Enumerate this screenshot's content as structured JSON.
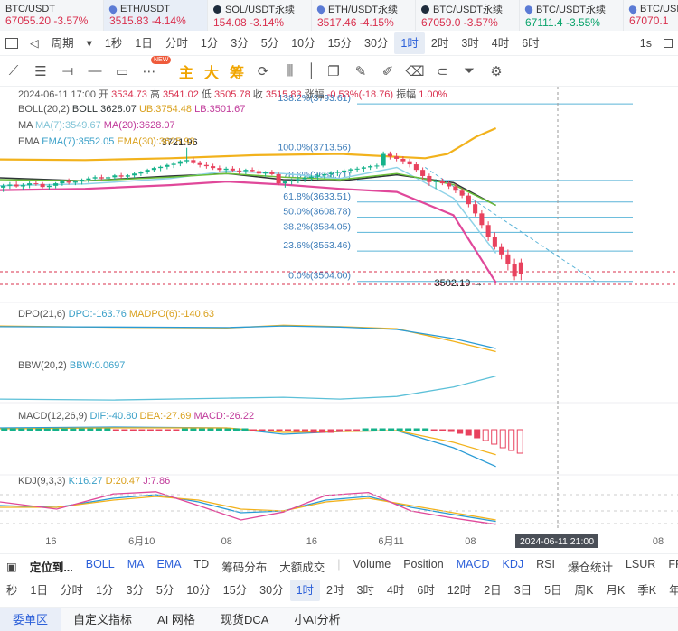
{
  "tickers": [
    {
      "symbol": "BTC/USDT",
      "price": "67055.20",
      "change": "-3.57%",
      "icon": "none",
      "up": false
    },
    {
      "symbol": "ETH/USDT",
      "price": "3515.83",
      "change": "-4.14%",
      "icon": "drop",
      "up": false,
      "active": true
    },
    {
      "symbol": "SOL/USDT永续",
      "price": "154.08",
      "change": "-3.14%",
      "icon": "dot",
      "up": false
    },
    {
      "symbol": "ETH/USDT永续",
      "price": "3517.46",
      "change": "-4.15%",
      "icon": "drop",
      "up": false
    },
    {
      "symbol": "BTC/USDT永续",
      "price": "67059.0",
      "change": "-3.57%",
      "icon": "dot",
      "up": false
    },
    {
      "symbol": "BTC/USDT永续",
      "price": "67111.4",
      "change": "-3.55%",
      "icon": "drop",
      "up": true
    },
    {
      "symbol": "BTC/USDT",
      "price": "67070.1",
      "change": "",
      "icon": "drop",
      "up": false
    }
  ],
  "timeframes": {
    "period_label": "周期",
    "items": [
      "1秒",
      "1日",
      "分时",
      "1分",
      "3分",
      "5分",
      "10分",
      "15分",
      "30分",
      "1时",
      "2时",
      "3时",
      "4时",
      "6时"
    ],
    "active": "1时",
    "right": "1s"
  },
  "toolbar": {
    "icons": [
      "line-tool-icon",
      "parallel-tool-icon",
      "hline-tool-icon",
      "rect-tool-icon",
      "more-tools-icon"
    ],
    "new_badge": "NEW",
    "cn_tools": [
      "主",
      "大",
      "筹"
    ]
  },
  "ohlc": {
    "date": "2024-06-11 17:00",
    "open_label": "开",
    "open": "3534.73",
    "high_label": "高",
    "high": "3541.02",
    "low_label": "低",
    "low": "3505.78",
    "close_label": "收",
    "close": "3515.83",
    "change_label": "涨幅",
    "change": "-0.53%(-18.76)",
    "amp_label": "振幅",
    "amp": "1.00%"
  },
  "indicators": {
    "boll": {
      "name": "BOLL(20,2)",
      "boll": "BOLL:3628.07",
      "ub": "UB:3754.48",
      "lb": "LB:3501.67"
    },
    "ma": {
      "name": "MA",
      "ma7": "MA(7):3549.67",
      "ma20": "MA(20):3628.07"
    },
    "ema": {
      "name": "EMA",
      "ema7": "EMA(7):3552.05",
      "ema30": "EMA(30):3625.93"
    },
    "dpo": {
      "name": "DPO(21,6)",
      "dpo": "DPO:-163.76",
      "madpo": "MADPO(6):-140.63"
    },
    "bbw": {
      "name": "BBW(20,2)",
      "bbw": "BBW:0.0697"
    },
    "macd": {
      "name": "MACD(12,26,9)",
      "dif": "DIF:-40.80",
      "dea": "DEA:-27.69",
      "macd": "MACD:-26.22"
    },
    "kdj": {
      "name": "KDJ(9,3,3)",
      "k": "K:16.27",
      "d": "D:20.47",
      "j": "J:7.86"
    }
  },
  "chart_data": {
    "type": "candlestick",
    "instrument": "ETH/USDT",
    "interval": "1时",
    "ylim": [
      3480,
      3810
    ],
    "fib_levels": [
      {
        "label": "138.2%(3793.61)",
        "value": 3793.61
      },
      {
        "label": "100.0%(3713.56)",
        "value": 3713.56
      },
      {
        "label": "78.6%(3668.71)",
        "value": 3668.71
      },
      {
        "label": "61.8%(3633.51)",
        "value": 3633.51
      },
      {
        "label": "50.0%(3608.78)",
        "value": 3608.78
      },
      {
        "label": "38.2%(3584.05)",
        "value": 3584.05
      },
      {
        "label": "23.6%(3553.46)",
        "value": 3553.46
      },
      {
        "label": "0.0%(3504.00)",
        "value": 3504.0
      }
    ],
    "annotations": [
      {
        "label": "3721.96",
        "value": 3721.96,
        "x": 50
      },
      {
        "label": "3502.19",
        "value": 3502.19,
        "x": 173
      }
    ],
    "x_labels": [
      {
        "label": "16",
        "x": 18
      },
      {
        "label": "6月10",
        "x": 50
      },
      {
        "label": "08",
        "x": 80
      },
      {
        "label": "16",
        "x": 110
      },
      {
        "label": "6月11",
        "x": 138
      },
      {
        "label": "08",
        "x": 166
      }
    ],
    "x_label_after_crosshair": "08",
    "crosshair_label": "2024-06-11 21:00",
    "candles": [
      [
        3657,
        3663,
        3650,
        3660
      ],
      [
        3660,
        3666,
        3655,
        3662
      ],
      [
        3662,
        3668,
        3657,
        3659
      ],
      [
        3659,
        3664,
        3653,
        3661
      ],
      [
        3661,
        3667,
        3656,
        3664
      ],
      [
        3664,
        3669,
        3660,
        3663
      ],
      [
        3663,
        3666,
        3656,
        3658
      ],
      [
        3658,
        3663,
        3653,
        3660
      ],
      [
        3660,
        3666,
        3656,
        3664
      ],
      [
        3664,
        3670,
        3660,
        3667
      ],
      [
        3667,
        3672,
        3662,
        3665
      ],
      [
        3665,
        3669,
        3661,
        3667
      ],
      [
        3667,
        3672,
        3662,
        3670
      ],
      [
        3670,
        3675,
        3665,
        3672
      ],
      [
        3672,
        3677,
        3668,
        3674
      ],
      [
        3674,
        3678,
        3669,
        3672
      ],
      [
        3672,
        3676,
        3667,
        3674
      ],
      [
        3674,
        3679,
        3670,
        3677
      ],
      [
        3677,
        3681,
        3672,
        3675
      ],
      [
        3675,
        3679,
        3671,
        3677
      ],
      [
        3677,
        3682,
        3673,
        3680
      ],
      [
        3680,
        3684,
        3676,
        3683
      ],
      [
        3683,
        3688,
        3679,
        3686
      ],
      [
        3686,
        3691,
        3682,
        3689
      ],
      [
        3689,
        3693,
        3684,
        3691
      ],
      [
        3691,
        3696,
        3687,
        3694
      ],
      [
        3694,
        3699,
        3689,
        3696
      ],
      [
        3696,
        3702,
        3692,
        3700
      ],
      [
        3700,
        3722,
        3696,
        3702
      ],
      [
        3702,
        3706,
        3695,
        3697
      ],
      [
        3697,
        3701,
        3690,
        3694
      ],
      [
        3694,
        3698,
        3688,
        3692
      ],
      [
        3692,
        3696,
        3686,
        3689
      ],
      [
        3689,
        3693,
        3683,
        3686
      ],
      [
        3686,
        3691,
        3681,
        3688
      ],
      [
        3688,
        3692,
        3683,
        3685
      ],
      [
        3685,
        3689,
        3679,
        3684
      ],
      [
        3684,
        3688,
        3679,
        3686
      ],
      [
        3686,
        3690,
        3682,
        3684
      ],
      [
        3684,
        3687,
        3678,
        3680
      ],
      [
        3680,
        3684,
        3675,
        3682
      ],
      [
        3682,
        3686,
        3677,
        3679
      ],
      [
        3679,
        3682,
        3661,
        3664
      ],
      [
        3664,
        3669,
        3657,
        3667
      ],
      [
        3667,
        3672,
        3662,
        3669
      ],
      [
        3669,
        3674,
        3664,
        3671
      ],
      [
        3671,
        3676,
        3666,
        3673
      ],
      [
        3673,
        3678,
        3668,
        3675
      ],
      [
        3675,
        3680,
        3670,
        3677
      ],
      [
        3677,
        3681,
        3672,
        3679
      ],
      [
        3679,
        3684,
        3674,
        3681
      ],
      [
        3681,
        3686,
        3676,
        3683
      ],
      [
        3683,
        3688,
        3678,
        3685
      ],
      [
        3685,
        3689,
        3680,
        3687
      ],
      [
        3687,
        3691,
        3682,
        3688
      ],
      [
        3688,
        3692,
        3683,
        3690
      ],
      [
        3690,
        3694,
        3686,
        3692
      ],
      [
        3692,
        3696,
        3688,
        3693
      ],
      [
        3693,
        3716,
        3690,
        3712
      ],
      [
        3712,
        3716,
        3703,
        3708
      ],
      [
        3708,
        3713,
        3700,
        3704
      ],
      [
        3704,
        3708,
        3695,
        3700
      ],
      [
        3700,
        3704,
        3690,
        3695
      ],
      [
        3695,
        3699,
        3683,
        3686
      ],
      [
        3686,
        3690,
        3670,
        3676
      ],
      [
        3676,
        3680,
        3660,
        3666
      ],
      [
        3666,
        3671,
        3655,
        3668
      ],
      [
        3668,
        3672,
        3661,
        3664
      ],
      [
        3664,
        3668,
        3655,
        3659
      ],
      [
        3659,
        3663,
        3648,
        3652
      ],
      [
        3652,
        3656,
        3640,
        3644
      ],
      [
        3644,
        3648,
        3625,
        3630
      ],
      [
        3630,
        3635,
        3610,
        3615
      ],
      [
        3615,
        3620,
        3590,
        3596
      ],
      [
        3596,
        3602,
        3570,
        3576
      ],
      [
        3576,
        3584,
        3556,
        3560
      ],
      [
        3560,
        3566,
        3540,
        3548
      ],
      [
        3548,
        3556,
        3522,
        3532
      ],
      [
        3532,
        3541,
        3506,
        3512
      ],
      [
        3535,
        3541,
        3506,
        3516
      ]
    ],
    "candle_x_range": [
      0,
      185
    ],
    "series_lines": [
      {
        "name": "UB",
        "color": "#f2b21c",
        "points": [
          [
            0,
            3703
          ],
          [
            30,
            3702
          ],
          [
            60,
            3705
          ],
          [
            90,
            3710
          ],
          [
            120,
            3712
          ],
          [
            150,
            3705
          ],
          [
            158,
            3712
          ],
          [
            168,
            3740
          ],
          [
            175,
            3754
          ]
        ]
      },
      {
        "name": "BOLL",
        "color": "#2d3436",
        "points": [
          [
            0,
            3673
          ],
          [
            30,
            3668
          ],
          [
            60,
            3676
          ],
          [
            80,
            3680
          ],
          [
            100,
            3670
          ],
          [
            120,
            3668
          ],
          [
            140,
            3678
          ],
          [
            160,
            3665
          ],
          [
            175,
            3628
          ]
        ]
      },
      {
        "name": "LB",
        "color": "#e0489a",
        "points": [
          [
            0,
            3653
          ],
          [
            30,
            3655
          ],
          [
            60,
            3661
          ],
          [
            80,
            3667
          ],
          [
            100,
            3662
          ],
          [
            120,
            3655
          ],
          [
            140,
            3650
          ],
          [
            160,
            3612
          ],
          [
            175,
            3502
          ]
        ]
      },
      {
        "name": "MA7",
        "color": "#8fd3e8",
        "points": [
          [
            0,
            3660
          ],
          [
            30,
            3663
          ],
          [
            60,
            3672
          ],
          [
            80,
            3684
          ],
          [
            100,
            3680
          ],
          [
            120,
            3672
          ],
          [
            140,
            3690
          ],
          [
            160,
            3640
          ],
          [
            175,
            3550
          ]
        ]
      },
      {
        "name": "MA20",
        "color": "#6bbf3a",
        "points": [
          [
            0,
            3670
          ],
          [
            30,
            3668
          ],
          [
            60,
            3674
          ],
          [
            80,
            3680
          ],
          [
            100,
            3674
          ],
          [
            120,
            3670
          ],
          [
            140,
            3680
          ],
          [
            160,
            3662
          ],
          [
            175,
            3628
          ]
        ]
      }
    ],
    "dashed_projection": [
      [
        150,
        3690
      ],
      [
        210,
        3504
      ]
    ],
    "dpo_series": [
      {
        "name": "DPO",
        "color": "#f2b21c",
        "points": [
          [
            0,
            20
          ],
          [
            40,
            10
          ],
          [
            80,
            5
          ],
          [
            100,
            25
          ],
          [
            120,
            15
          ],
          [
            140,
            0
          ],
          [
            160,
            -90
          ],
          [
            175,
            -164
          ]
        ]
      },
      {
        "name": "MADPO",
        "color": "#2a9bd5",
        "points": [
          [
            0,
            15
          ],
          [
            40,
            12
          ],
          [
            80,
            8
          ],
          [
            100,
            20
          ],
          [
            120,
            12
          ],
          [
            140,
            -5
          ],
          [
            160,
            -70
          ],
          [
            175,
            -141
          ]
        ]
      }
    ],
    "bbw_series": [
      {
        "name": "BBW",
        "color": "#5cc0d8",
        "points": [
          [
            0,
            0.018
          ],
          [
            40,
            0.016
          ],
          [
            80,
            0.02
          ],
          [
            100,
            0.022
          ],
          [
            120,
            0.018
          ],
          [
            140,
            0.024
          ],
          [
            160,
            0.045
          ],
          [
            175,
            0.0697
          ]
        ]
      }
    ],
    "macd_series": [
      {
        "name": "DIF",
        "color": "#2a9bd5",
        "points": [
          [
            0,
            2
          ],
          [
            40,
            3
          ],
          [
            80,
            2
          ],
          [
            100,
            -5
          ],
          [
            120,
            -2
          ],
          [
            140,
            -1
          ],
          [
            160,
            -20
          ],
          [
            175,
            -40.8
          ]
        ]
      },
      {
        "name": "DEA",
        "color": "#f2b21c",
        "points": [
          [
            0,
            1
          ],
          [
            40,
            2
          ],
          [
            80,
            2
          ],
          [
            100,
            -3
          ],
          [
            120,
            -2
          ],
          [
            140,
            -1
          ],
          [
            160,
            -14
          ],
          [
            175,
            -27.7
          ]
        ]
      }
    ],
    "macd_hist": [
      1,
      1,
      1,
      1,
      1,
      1,
      1,
      1,
      1,
      1,
      1,
      1,
      1,
      -1,
      -1,
      -1,
      -1,
      -1,
      -1,
      -1,
      -1,
      1,
      1,
      1,
      1,
      1,
      1,
      1,
      1,
      -1,
      -1,
      -1,
      -1,
      -1,
      -2,
      -2,
      -3,
      -3,
      -3,
      -2,
      -1,
      -1,
      1,
      1,
      1,
      1,
      1,
      1,
      1,
      1,
      -1,
      -1,
      -2,
      -4,
      -6,
      -9,
      -12,
      -16,
      -20,
      -23,
      -26
    ],
    "kdj_series": [
      {
        "name": "K",
        "color": "#2a9bd5",
        "points": [
          [
            0,
            60
          ],
          [
            20,
            55
          ],
          [
            40,
            80
          ],
          [
            55,
            90
          ],
          [
            70,
            70
          ],
          [
            85,
            40
          ],
          [
            100,
            45
          ],
          [
            115,
            75
          ],
          [
            130,
            85
          ],
          [
            145,
            55
          ],
          [
            160,
            35
          ],
          [
            175,
            16
          ]
        ]
      },
      {
        "name": "D",
        "color": "#f2b21c",
        "points": [
          [
            0,
            55
          ],
          [
            20,
            55
          ],
          [
            40,
            75
          ],
          [
            55,
            85
          ],
          [
            70,
            75
          ],
          [
            85,
            50
          ],
          [
            100,
            45
          ],
          [
            115,
            70
          ],
          [
            130,
            80
          ],
          [
            145,
            60
          ],
          [
            160,
            40
          ],
          [
            175,
            20
          ]
        ]
      },
      {
        "name": "J",
        "color": "#e0489a",
        "points": [
          [
            0,
            70
          ],
          [
            20,
            50
          ],
          [
            40,
            92
          ],
          [
            55,
            98
          ],
          [
            70,
            60
          ],
          [
            85,
            20
          ],
          [
            100,
            42
          ],
          [
            115,
            88
          ],
          [
            130,
            96
          ],
          [
            145,
            45
          ],
          [
            160,
            25
          ],
          [
            175,
            8
          ]
        ]
      }
    ]
  },
  "indicator_tabs": {
    "lead": "定位到...",
    "items": [
      "BOLL",
      "MA",
      "EMA",
      "TD",
      "筹码分布",
      "大额成交",
      "Volume",
      "Position",
      "MACD",
      "KDJ",
      "RSI",
      "爆仓统计",
      "LSUR",
      "FR"
    ],
    "active": [
      "BOLL",
      "MA",
      "EMA",
      "MACD",
      "KDJ"
    ]
  },
  "timeframes2": {
    "items": [
      "秒",
      "1日",
      "分时",
      "1分",
      "3分",
      "5分",
      "10分",
      "15分",
      "30分",
      "1时",
      "2时",
      "3时",
      "4时",
      "6时",
      "12时",
      "2日",
      "3日",
      "5日",
      "周K",
      "月K",
      "季K",
      "年K"
    ],
    "active": "1时",
    "close": "✕"
  },
  "bottom_tabs": {
    "items": [
      "委单区",
      "自定义指标",
      "AI 网格",
      "现货DCA",
      "小AI分析"
    ],
    "active": "委单区"
  }
}
